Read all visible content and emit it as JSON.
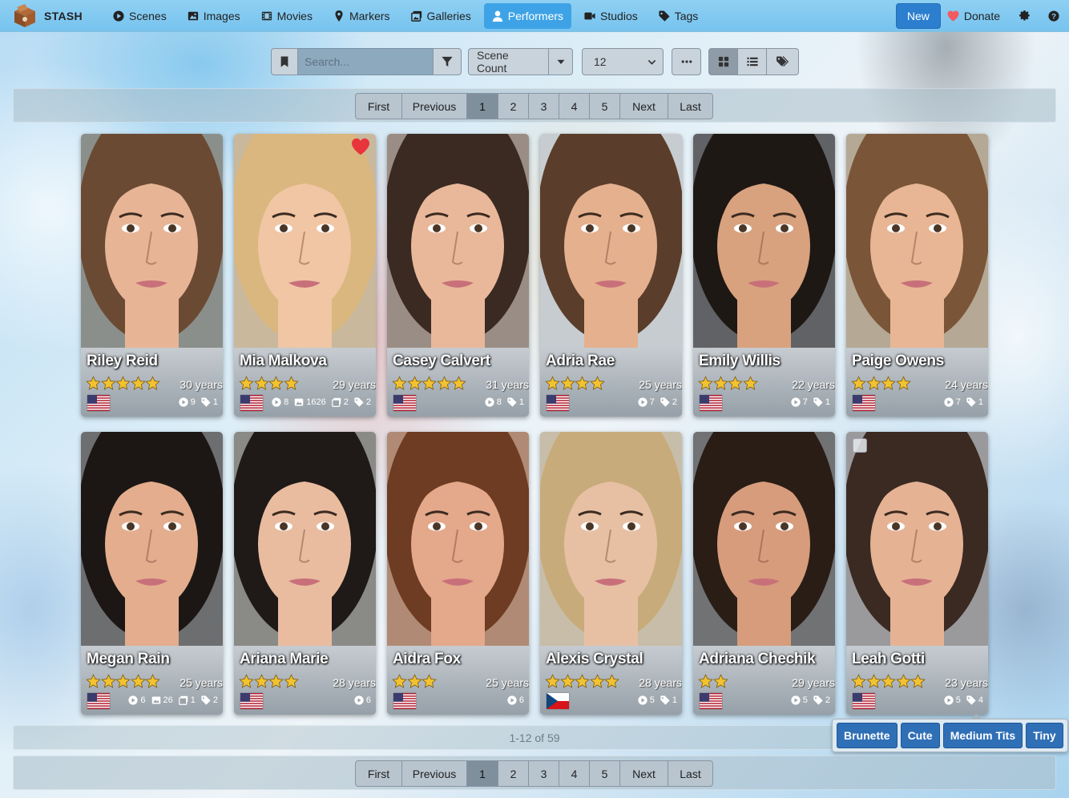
{
  "nav": {
    "brand": "STASH",
    "items": [
      {
        "label": "Scenes",
        "icon": "play-circle-icon"
      },
      {
        "label": "Images",
        "icon": "image-icon"
      },
      {
        "label": "Movies",
        "icon": "film-icon"
      },
      {
        "label": "Markers",
        "icon": "map-marker-icon"
      },
      {
        "label": "Galleries",
        "icon": "images-icon"
      },
      {
        "label": "Performers",
        "icon": "user-icon",
        "active": true
      },
      {
        "label": "Studios",
        "icon": "video-icon"
      },
      {
        "label": "Tags",
        "icon": "tag-icon"
      }
    ],
    "new_label": "New",
    "donate_label": "Donate"
  },
  "toolbar": {
    "search_placeholder": "Search...",
    "sort_by": "Scene Count",
    "per_page": "12"
  },
  "pagination": {
    "first": "First",
    "previous": "Previous",
    "pages": [
      "1",
      "2",
      "3",
      "4",
      "5"
    ],
    "current": "1",
    "next": "Next",
    "last": "Last"
  },
  "performers": [
    {
      "name": "Riley Reid",
      "age": "30 years",
      "rating": 5,
      "flag": "us",
      "favorite": false,
      "counts": [
        {
          "icon": "play-circle-icon",
          "value": "9"
        },
        {
          "icon": "tag-icon",
          "value": "1"
        }
      ]
    },
    {
      "name": "Mia Malkova",
      "age": "29 years",
      "rating": 4,
      "flag": "us",
      "favorite": true,
      "counts": [
        {
          "icon": "play-circle-icon",
          "value": "8"
        },
        {
          "icon": "image-icon",
          "value": "1626"
        },
        {
          "icon": "images-icon",
          "value": "2"
        },
        {
          "icon": "tag-icon",
          "value": "2"
        }
      ]
    },
    {
      "name": "Casey Calvert",
      "age": "31 years",
      "rating": 5,
      "flag": "us",
      "favorite": false,
      "counts": [
        {
          "icon": "play-circle-icon",
          "value": "8"
        },
        {
          "icon": "tag-icon",
          "value": "1"
        }
      ]
    },
    {
      "name": "Adria Rae",
      "age": "25 years",
      "rating": 4,
      "flag": "us",
      "favorite": false,
      "counts": [
        {
          "icon": "play-circle-icon",
          "value": "7"
        },
        {
          "icon": "tag-icon",
          "value": "2"
        }
      ]
    },
    {
      "name": "Emily Willis",
      "age": "22 years",
      "rating": 4,
      "flag": "us",
      "favorite": false,
      "counts": [
        {
          "icon": "play-circle-icon",
          "value": "7"
        },
        {
          "icon": "tag-icon",
          "value": "1"
        }
      ]
    },
    {
      "name": "Paige Owens",
      "age": "24 years",
      "rating": 4,
      "flag": "us",
      "favorite": false,
      "counts": [
        {
          "icon": "play-circle-icon",
          "value": "7"
        },
        {
          "icon": "tag-icon",
          "value": "1"
        }
      ]
    },
    {
      "name": "Megan Rain",
      "age": "25 years",
      "rating": 5,
      "flag": "us",
      "favorite": false,
      "counts": [
        {
          "icon": "play-circle-icon",
          "value": "6"
        },
        {
          "icon": "image-icon",
          "value": "26"
        },
        {
          "icon": "images-icon",
          "value": "1"
        },
        {
          "icon": "tag-icon",
          "value": "2"
        }
      ]
    },
    {
      "name": "Ariana Marie",
      "age": "28 years",
      "rating": 4,
      "flag": "us",
      "favorite": false,
      "counts": [
        {
          "icon": "play-circle-icon",
          "value": "6"
        }
      ]
    },
    {
      "name": "Aidra Fox",
      "age": "25 years",
      "rating": 3,
      "flag": "us",
      "favorite": false,
      "counts": [
        {
          "icon": "play-circle-icon",
          "value": "6"
        }
      ]
    },
    {
      "name": "Alexis Crystal",
      "age": "28 years",
      "rating": 5,
      "flag": "cz",
      "favorite": false,
      "counts": [
        {
          "icon": "play-circle-icon",
          "value": "5"
        },
        {
          "icon": "tag-icon",
          "value": "1"
        }
      ]
    },
    {
      "name": "Adriana Chechik",
      "age": "29 years",
      "rating": 2,
      "flag": "us",
      "favorite": false,
      "counts": [
        {
          "icon": "play-circle-icon",
          "value": "5"
        },
        {
          "icon": "tag-icon",
          "value": "2"
        }
      ]
    },
    {
      "name": "Leah Gotti",
      "age": "23 years",
      "rating": 5,
      "flag": "us",
      "favorite": false,
      "checkbox": true,
      "counts": [
        {
          "icon": "play-circle-icon",
          "value": "5"
        },
        {
          "icon": "tag-icon",
          "value": "4"
        }
      ]
    }
  ],
  "result_count": "1-12 of 59",
  "tag_popover": [
    "Brunette",
    "Cute",
    "Medium Tits",
    "Tiny"
  ],
  "colors": {
    "navbar": "#76c3ef",
    "active_nav": "#3ea3e6",
    "new_button": "#2c7fcf",
    "heart": "#e8343b",
    "star": "#f2c230",
    "tag": "#2f6fb6"
  }
}
